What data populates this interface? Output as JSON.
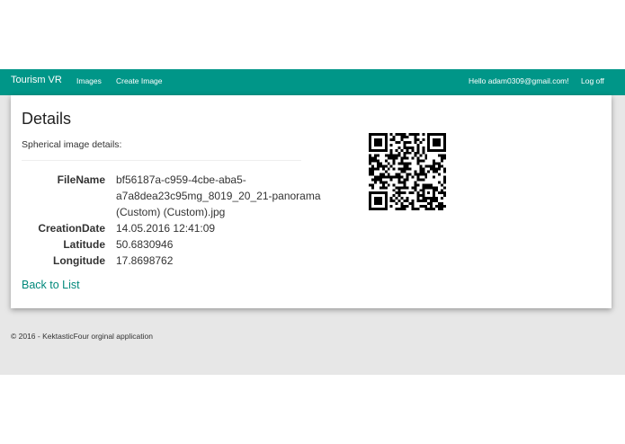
{
  "navbar": {
    "brand": "Tourism VR",
    "links": [
      "Images",
      "Create Image"
    ],
    "user_greeting": "Hello adam0309@gmail.com!",
    "logoff": "Log off"
  },
  "details": {
    "title": "Details",
    "subtitle": "Spherical image details:",
    "fields": [
      {
        "label": "FileName",
        "value": "bf56187a-c959-4cbe-aba5-a7a8dea23c95mg_8019_20_21-panorama (Custom) (Custom).jpg"
      },
      {
        "label": "CreationDate",
        "value": "14.05.2016 12:41:09"
      },
      {
        "label": "Latitude",
        "value": "50.6830946"
      },
      {
        "label": "Longitude",
        "value": "17.8698762"
      }
    ],
    "back_link": "Back to List"
  },
  "footer": {
    "text": "© 2016 - KektasticFour orginal application"
  },
  "colors": {
    "navbar": "#009688",
    "link": "#00897b",
    "background": "#e7e7e7"
  }
}
